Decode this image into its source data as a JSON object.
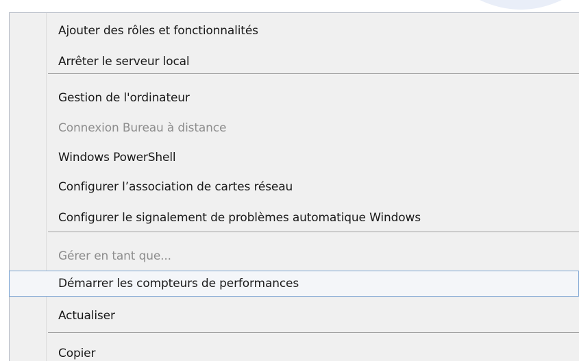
{
  "context_menu": {
    "items": [
      {
        "label": "Ajouter des rôles et fonctionnalités",
        "enabled": true
      },
      {
        "label": "Arrêter le serveur local",
        "enabled": true
      },
      {
        "label": "Gestion de l'ordinateur",
        "enabled": true
      },
      {
        "label": "Connexion Bureau à distance",
        "enabled": false
      },
      {
        "label": "Windows PowerShell",
        "enabled": true
      },
      {
        "label": "Configurer l’association de cartes réseau",
        "enabled": true
      },
      {
        "label": "Configurer le signalement de problèmes automatique Windows",
        "enabled": true
      },
      {
        "label": "Gérer en tant que...",
        "enabled": false
      },
      {
        "label": "Démarrer les compteurs de performances",
        "enabled": true,
        "highlighted": true
      },
      {
        "label": "Actualiser",
        "enabled": true
      },
      {
        "label": "Copier",
        "enabled": true
      }
    ]
  },
  "colors": {
    "menu_background": "#f0f0f0",
    "text": "#1a1a1a",
    "disabled_text": "#8d8d8d",
    "highlight_border": "#7aa3d2",
    "separator": "#a0a0a0"
  }
}
